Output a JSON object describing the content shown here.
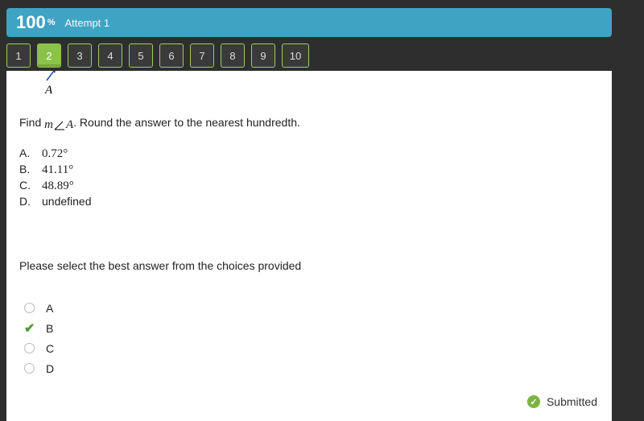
{
  "header": {
    "score": "100",
    "percent": "%",
    "attempt": "Attempt 1"
  },
  "nav": {
    "items": [
      "1",
      "2",
      "3",
      "4",
      "5",
      "6",
      "7",
      "8",
      "9",
      "10"
    ],
    "active_index": 1
  },
  "figure": {
    "vertex_label": "A"
  },
  "question": {
    "prefix": "Find ",
    "expr_m": "m",
    "expr_A": "A",
    "suffix": ". Round the answer to the nearest hundredth."
  },
  "choices": [
    {
      "key": "A.",
      "value": "0.72°"
    },
    {
      "key": "B.",
      "value": "41.11°"
    },
    {
      "key": "C.",
      "value": "48.89°"
    },
    {
      "key": "D.",
      "value": "undefined",
      "plain": true
    }
  ],
  "prompt": "Please select the best answer from the choices provided",
  "answers": [
    {
      "label": "A",
      "selected": false
    },
    {
      "label": "B",
      "selected": true
    },
    {
      "label": "C",
      "selected": false
    },
    {
      "label": "D",
      "selected": false
    }
  ],
  "status": {
    "label": "Submitted"
  }
}
